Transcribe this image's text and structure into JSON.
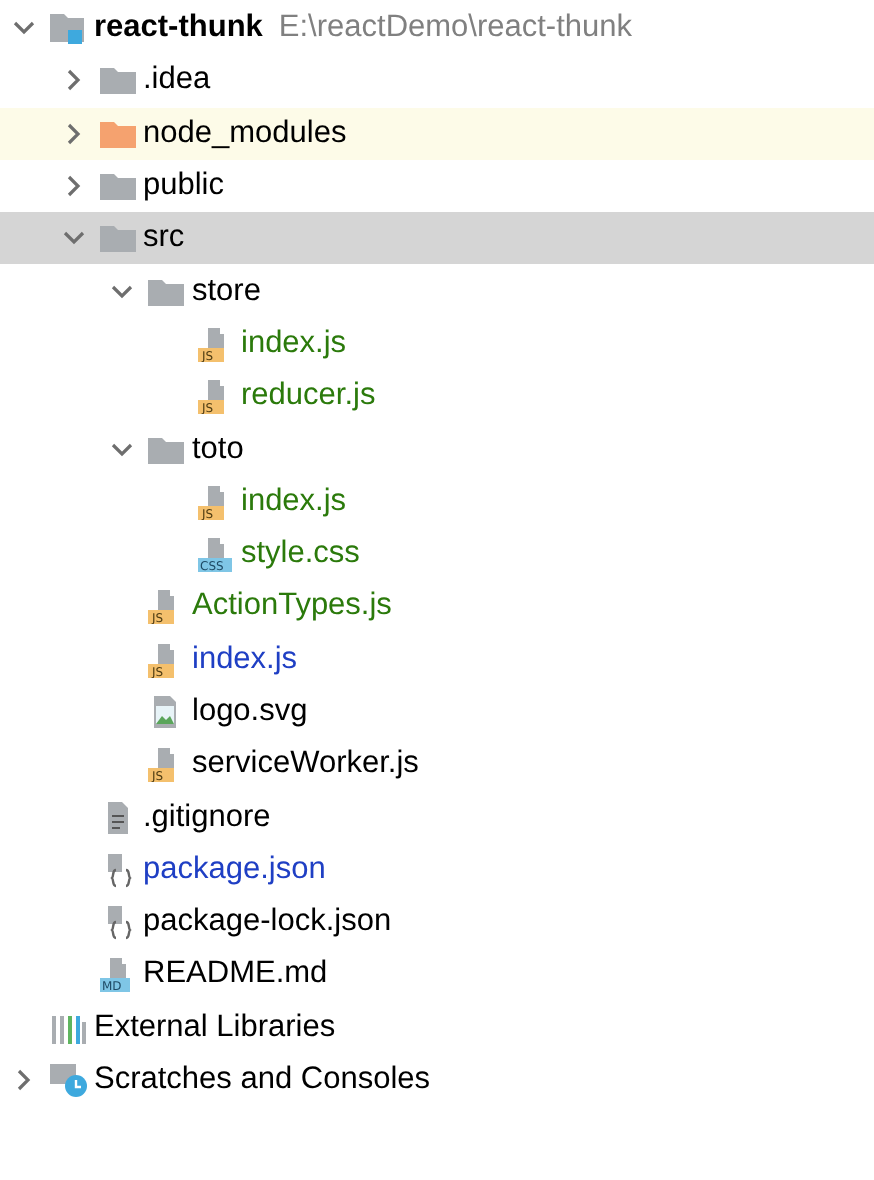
{
  "tree": [
    {
      "name": "react-thunk",
      "path": "E:\\reactDemo\\react-thunk",
      "kind": "project",
      "expanded": true,
      "selected": false,
      "highlighted": false,
      "color": "#000000",
      "children": [
        {
          "name": ".idea",
          "kind": "folder",
          "expanded": false,
          "selected": false,
          "highlighted": false,
          "color": "#000000"
        },
        {
          "name": "node_modules",
          "kind": "excluded-folder",
          "expanded": false,
          "selected": false,
          "highlighted": true,
          "color": "#000000"
        },
        {
          "name": "public",
          "kind": "folder",
          "expanded": false,
          "selected": false,
          "highlighted": false,
          "color": "#000000"
        },
        {
          "name": "src",
          "kind": "folder",
          "expanded": true,
          "selected": true,
          "highlighted": false,
          "color": "#000000",
          "children": [
            {
              "name": "store",
              "kind": "folder",
              "expanded": true,
              "selected": false,
              "highlighted": false,
              "color": "#000000",
              "children": [
                {
                  "name": "index.js",
                  "kind": "js",
                  "badge": "JS",
                  "selected": false,
                  "highlighted": false,
                  "color": "#2b7a0b"
                },
                {
                  "name": "reducer.js",
                  "kind": "js",
                  "badge": "JS",
                  "selected": false,
                  "highlighted": false,
                  "color": "#2b7a0b"
                }
              ]
            },
            {
              "name": "toto",
              "kind": "folder",
              "expanded": true,
              "selected": false,
              "highlighted": false,
              "color": "#000000",
              "children": [
                {
                  "name": "index.js",
                  "kind": "js",
                  "badge": "JS",
                  "selected": false,
                  "highlighted": false,
                  "color": "#2b7a0b"
                },
                {
                  "name": "style.css",
                  "kind": "css",
                  "badge": "CSS",
                  "selected": false,
                  "highlighted": false,
                  "color": "#2b7a0b"
                }
              ]
            },
            {
              "name": "ActionTypes.js",
              "kind": "js",
              "badge": "JS",
              "selected": false,
              "highlighted": false,
              "color": "#2b7a0b"
            },
            {
              "name": "index.js",
              "kind": "js",
              "badge": "JS",
              "selected": false,
              "highlighted": false,
              "color": "#1f3fc4"
            },
            {
              "name": "logo.svg",
              "kind": "image",
              "selected": false,
              "highlighted": false,
              "color": "#000000"
            },
            {
              "name": "serviceWorker.js",
              "kind": "js",
              "badge": "JS",
              "selected": false,
              "highlighted": false,
              "color": "#000000"
            }
          ]
        },
        {
          "name": ".gitignore",
          "kind": "text",
          "selected": false,
          "highlighted": false,
          "color": "#000000"
        },
        {
          "name": "package.json",
          "kind": "json",
          "selected": false,
          "highlighted": false,
          "color": "#1f3fc4"
        },
        {
          "name": "package-lock.json",
          "kind": "json",
          "selected": false,
          "highlighted": false,
          "color": "#000000"
        },
        {
          "name": "README.md",
          "kind": "md",
          "badge": "MD",
          "selected": false,
          "highlighted": false,
          "color": "#000000"
        }
      ]
    },
    {
      "name": "External Libraries",
      "kind": "libraries",
      "selected": false,
      "highlighted": false,
      "color": "#000000"
    },
    {
      "name": "Scratches and Consoles",
      "kind": "scratches",
      "expanded": false,
      "selected": false,
      "highlighted": false,
      "color": "#000000"
    }
  ]
}
